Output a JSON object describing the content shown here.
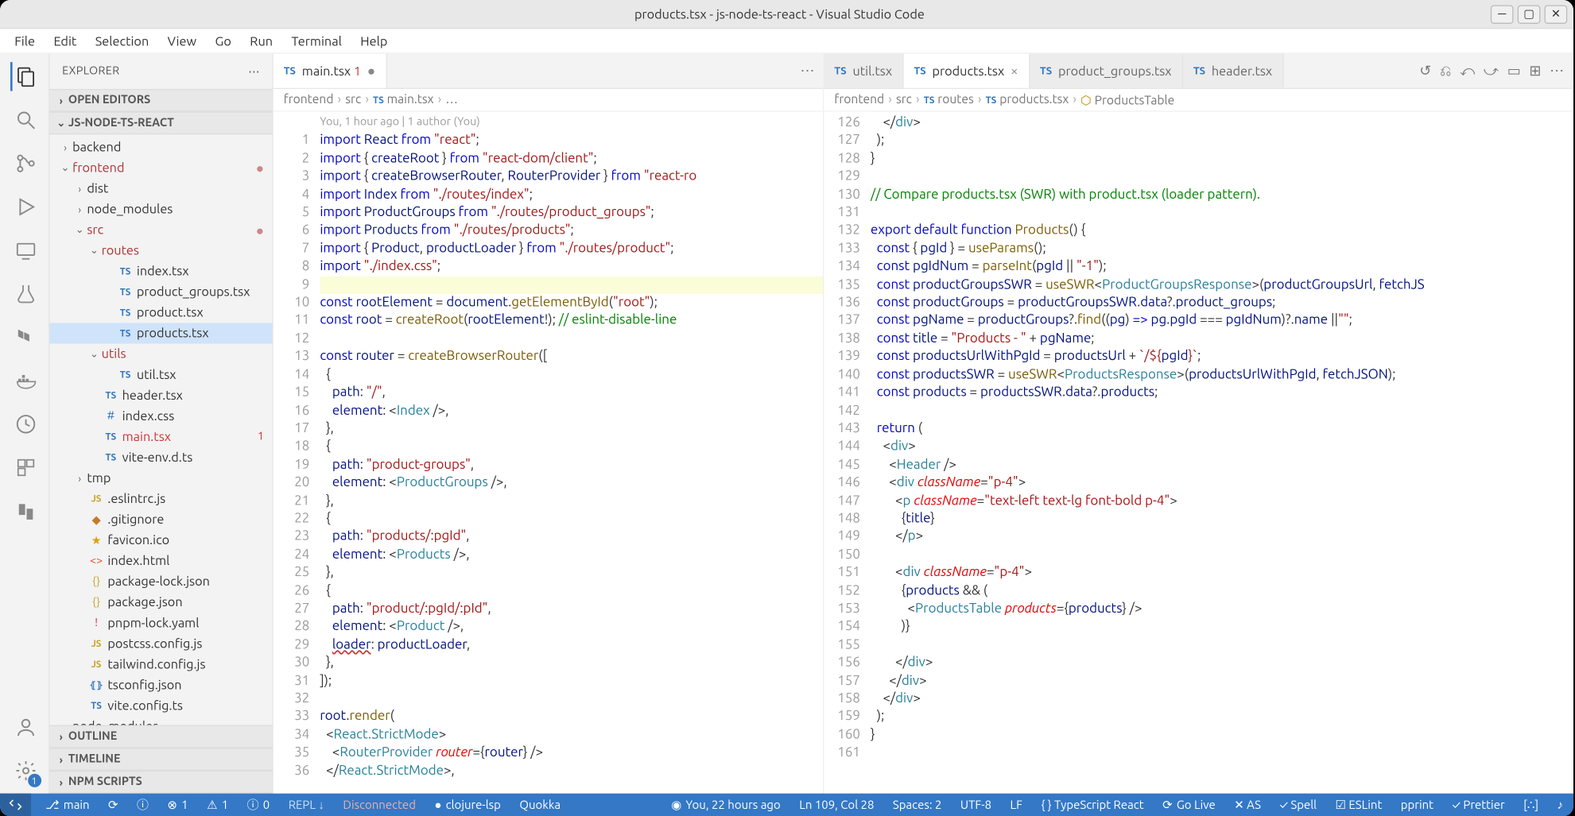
{
  "title": "products.tsx - js-node-ts-react - Visual Studio Code",
  "menu": [
    "File",
    "Edit",
    "Selection",
    "View",
    "Go",
    "Run",
    "Terminal",
    "Help"
  ],
  "explorer": {
    "title": "EXPLORER",
    "sections": {
      "openEditors": "OPEN EDITORS",
      "project": "JS-NODE-TS-REACT",
      "outline": "OUTLINE",
      "timeline": "TIMELINE",
      "npm": "NPM SCRIPTS"
    },
    "tree": [
      {
        "depth": 0,
        "kind": "folder",
        "open": false,
        "label": "backend"
      },
      {
        "depth": 0,
        "kind": "folder",
        "open": true,
        "label": "frontend",
        "dot": true
      },
      {
        "depth": 1,
        "kind": "folder",
        "open": false,
        "label": "dist"
      },
      {
        "depth": 1,
        "kind": "folder",
        "open": false,
        "label": "node_modules"
      },
      {
        "depth": 1,
        "kind": "folder",
        "open": true,
        "label": "src",
        "dot": true
      },
      {
        "depth": 2,
        "kind": "folder",
        "open": true,
        "label": "routes"
      },
      {
        "depth": 3,
        "kind": "ts",
        "label": "index.tsx"
      },
      {
        "depth": 3,
        "kind": "ts",
        "label": "product_groups.tsx"
      },
      {
        "depth": 3,
        "kind": "ts",
        "label": "product.tsx"
      },
      {
        "depth": 3,
        "kind": "ts",
        "label": "products.tsx",
        "selected": true
      },
      {
        "depth": 2,
        "kind": "folder",
        "open": true,
        "label": "utils"
      },
      {
        "depth": 3,
        "kind": "ts",
        "label": "util.tsx"
      },
      {
        "depth": 2,
        "kind": "ts",
        "label": "header.tsx"
      },
      {
        "depth": 2,
        "kind": "css",
        "label": "index.css"
      },
      {
        "depth": 2,
        "kind": "ts",
        "label": "main.tsx",
        "err": "1"
      },
      {
        "depth": 2,
        "kind": "ts",
        "label": "vite-env.d.ts"
      },
      {
        "depth": 1,
        "kind": "folder",
        "open": false,
        "label": "tmp"
      },
      {
        "depth": 1,
        "kind": "js",
        "label": ".eslintrc.js"
      },
      {
        "depth": 1,
        "kind": "git",
        "label": ".gitignore"
      },
      {
        "depth": 1,
        "kind": "star",
        "label": "favicon.ico"
      },
      {
        "depth": 1,
        "kind": "html",
        "label": "index.html"
      },
      {
        "depth": 1,
        "kind": "json",
        "label": "package-lock.json"
      },
      {
        "depth": 1,
        "kind": "json",
        "label": "package.json"
      },
      {
        "depth": 1,
        "kind": "yaml",
        "label": "pnpm-lock.yaml"
      },
      {
        "depth": 1,
        "kind": "js",
        "label": "postcss.config.js"
      },
      {
        "depth": 1,
        "kind": "js",
        "label": "tailwind.config.js"
      },
      {
        "depth": 1,
        "kind": "tsconf",
        "label": "tsconfig.json"
      },
      {
        "depth": 1,
        "kind": "ts",
        "label": "vite.config.ts"
      },
      {
        "depth": 0,
        "kind": "folder",
        "open": false,
        "label": "node_modules"
      }
    ]
  },
  "leftGroup": {
    "tabs": [
      {
        "label": "main.tsx",
        "dirty": true,
        "active": true,
        "badge": "1"
      }
    ],
    "actionsEllipsis": "⋯",
    "breadcrumb": [
      "frontend",
      "src",
      "main.tsx",
      "…"
    ],
    "codelens": "You, 1 hour ago | 1 author (You)",
    "startLine": 1,
    "lines": [
      "<span class='tok-kw'>import</span> <span class='tok-var'>React</span> <span class='tok-kw'>from</span> <span class='tok-str'>\"react\"</span>;",
      "<span class='tok-kw'>import</span> { <span class='tok-var'>createRoot</span> } <span class='tok-kw'>from</span> <span class='tok-str'>\"react-dom/client\"</span>;",
      "<span class='tok-kw'>import</span> { <span class='tok-var'>createBrowserRouter</span>, <span class='tok-var'>RouterProvider</span> } <span class='tok-kw'>from</span> <span class='tok-str'>\"react-ro</span>",
      "<span class='tok-kw'>import</span> <span class='tok-var'>Index</span> <span class='tok-kw'>from</span> <span class='tok-str'>\"./routes/index\"</span>;",
      "<span class='tok-kw'>import</span> <span class='tok-var'>ProductGroups</span> <span class='tok-kw'>from</span> <span class='tok-str'>\"./routes/product_groups\"</span>;",
      "<span class='tok-kw'>import</span> <span class='tok-var'>Products</span> <span class='tok-kw'>from</span> <span class='tok-str'>\"./routes/products\"</span>;",
      "<span class='tok-kw'>import</span> { <span class='tok-var'>Product</span>, <span class='tok-var'>productLoader</span> } <span class='tok-kw'>from</span> <span class='tok-str'>\"./routes/product\"</span>;",
      "<span class='tok-kw'>import</span> <span class='tok-str'>\"./index.css\"</span>;",
      "<span class='hl-line'> </span>",
      "<span class='tok-kw'>const</span> <span class='tok-var'>rootElement</span> = <span class='tok-var'>document</span>.<span class='tok-fn'>getElementById</span>(<span class='tok-str'>\"root\"</span>);",
      "<span class='tok-kw'>const</span> <span class='tok-var'>root</span> = <span class='tok-fn'>createRoot</span>(<span class='tok-var'>rootElement</span>!); <span class='tok-comment'>// eslint-disable-line</span>",
      "",
      "<span class='tok-kw'>const</span> <span class='tok-var'>router</span> = <span class='tok-fn'>createBrowserRouter</span>([",
      "  {",
      "    <span class='tok-var'>path</span>: <span class='tok-str'>\"/\"</span>,",
      "    <span class='tok-var'>element</span>: &lt;<span class='tok-type'>Index</span> /&gt;,",
      "  },",
      "  {",
      "    <span class='tok-var'>path</span>: <span class='tok-str'>\"product-groups\"</span>,",
      "    <span class='tok-var'>element</span>: &lt;<span class='tok-type'>ProductGroups</span> /&gt;,",
      "  },",
      "  {",
      "    <span class='tok-var'>path</span>: <span class='tok-str'>\"products/:pgId\"</span>,",
      "    <span class='tok-var'>element</span>: &lt;<span class='tok-type'>Products</span> /&gt;,",
      "  },",
      "  {",
      "    <span class='tok-var'>path</span>: <span class='tok-str'>\"product/:pgId/:pId\"</span>,",
      "    <span class='tok-var'>element</span>: &lt;<span class='tok-type'>Product</span> /&gt;,",
      "    <span class='tok-var err-sq'>loader</span>: <span class='tok-var'>productLoader</span>,",
      "  },",
      "]);",
      "",
      "<span class='tok-var'>root</span>.<span class='tok-fn'>render</span>(",
      "  &lt;<span class='tok-type'>React.StrictMode</span>&gt;",
      "    &lt;<span class='tok-type'>RouterProvider</span> <span class='tok-attr'>router</span>={<span class='tok-var'>router</span>} /&gt;",
      "  &lt;/<span class='tok-type'>React.StrictMode</span>&gt;,"
    ]
  },
  "rightGroup": {
    "tabs": [
      {
        "label": "util.tsx",
        "active": false
      },
      {
        "label": "products.tsx",
        "active": true,
        "close": "×"
      },
      {
        "label": "product_groups.tsx",
        "active": false
      },
      {
        "label": "header.tsx",
        "active": false
      }
    ],
    "toolbarIcons": [
      "↺",
      "⎌",
      "⤺",
      "⤻",
      "▭",
      "⊞",
      "⋯"
    ],
    "breadcrumb": [
      "frontend",
      "src",
      "routes",
      "products.tsx",
      "ProductsTable"
    ],
    "startLine": 126,
    "lines": [
      "    &lt;/<span class='tok-type'>div</span>&gt;",
      "  );",
      "}",
      "",
      "<span class='tok-comment'>// Compare products.tsx (SWR) with product.tsx (loader pattern).</span>",
      "",
      "<span class='tok-kw'>export</span> <span class='tok-kw'>default</span> <span class='tok-kw'>function</span> <span class='tok-fn'>Products</span>() {",
      "  <span class='tok-kw'>const</span> { <span class='tok-var'>pgId</span> } = <span class='tok-fn'>useParams</span>();",
      "  <span class='tok-kw'>const</span> <span class='tok-var'>pgIdNum</span> = <span class='tok-fn'>parseInt</span>(<span class='tok-var'>pgId</span> || <span class='tok-str'>\"-1\"</span>);",
      "  <span class='tok-kw'>const</span> <span class='tok-var'>productGroupsSWR</span> = <span class='tok-fn'>useSWR</span>&lt;<span class='tok-type'>ProductGroupsResponse</span>&gt;(<span class='tok-var'>productGroupsUrl</span>, <span class='tok-var'>fetchJS</span>",
      "  <span class='tok-kw'>const</span> <span class='tok-var'>productGroups</span> = <span class='tok-var'>productGroupsSWR</span>.<span class='tok-var'>data</span>?.<span class='tok-var'>product_groups</span>;",
      "  <span class='tok-kw'>const</span> <span class='tok-var'>pgName</span> = <span class='tok-var'>productGroups</span>?.<span class='tok-fn'>find</span>((<span class='tok-var'>pg</span>) <span class='tok-kw'>=&gt;</span> <span class='tok-var'>pg</span>.<span class='tok-var'>pgId</span> === <span class='tok-var'>pgIdNum</span>)?.<span class='tok-var'>name</span> ||<span class='tok-str'>\"\"</span>;",
      "  <span class='tok-kw'>const</span> <span class='tok-var'>title</span> = <span class='tok-str'>\"Products - \"</span> + <span class='tok-var'>pgName</span>;",
      "  <span class='tok-kw'>const</span> <span class='tok-var'>productsUrlWithPgId</span> = <span class='tok-var'>productsUrl</span> + <span class='tok-str'>`/${</span><span class='tok-var'>pgId</span><span class='tok-str'>}`</span>;",
      "  <span class='tok-kw'>const</span> <span class='tok-var'>productsSWR</span> = <span class='tok-fn'>useSWR</span>&lt;<span class='tok-type'>ProductsResponse</span>&gt;(<span class='tok-var'>productsUrlWithPgId</span>, <span class='tok-var'>fetchJSON</span>);",
      "  <span class='tok-kw'>const</span> <span class='tok-var'>products</span> = <span class='tok-var'>productsSWR</span>.<span class='tok-var'>data</span>?.<span class='tok-var'>products</span>;",
      "",
      "  <span class='tok-kw'>return</span> (",
      "    &lt;<span class='tok-type'>div</span>&gt;",
      "      &lt;<span class='tok-type'>Header</span> /&gt;",
      "      &lt;<span class='tok-type'>div</span> <span class='tok-attr'>className</span>=<span class='tok-str'>\"p-4\"</span>&gt;",
      "        &lt;<span class='tok-type'>p</span> <span class='tok-attr'>className</span>=<span class='tok-str'>\"text-left text-lg font-bold p-4\"</span>&gt;",
      "          {<span class='tok-var'>title</span>}",
      "        &lt;/<span class='tok-type'>p</span>&gt;",
      "",
      "        &lt;<span class='tok-type'>div</span> <span class='tok-attr'>className</span>=<span class='tok-str'>\"p-4\"</span>&gt;",
      "          {<span class='tok-var'>products</span> &amp;&amp; (",
      "            &lt;<span class='tok-type'>ProductsTable</span> <span class='tok-attr'>products</span>={<span class='tok-var'>products</span>} /&gt;",
      "          )}",
      "",
      "        &lt;/<span class='tok-type'>div</span>&gt;",
      "      &lt;/<span class='tok-type'>div</span>&gt;",
      "    &lt;/<span class='tok-type'>div</span>&gt;",
      "  );",
      "}",
      ""
    ]
  },
  "status": {
    "left": [
      {
        "icon": "⎇",
        "text": "main"
      },
      {
        "icon": "⟳",
        "text": ""
      },
      {
        "icon": "ⓘ",
        "text": ""
      },
      {
        "icon": "⊗",
        "text": "1"
      },
      {
        "icon": "⚠",
        "text": "1"
      },
      {
        "icon": "ⓘ",
        "text": "0"
      },
      {
        "text": "REPL ↓",
        "dim": true
      },
      {
        "text": "Disconnected",
        "disc": true
      },
      {
        "icon": "●",
        "text": "clojure-lsp"
      },
      {
        "text": "Quokka"
      }
    ],
    "right": [
      {
        "icon": "◉",
        "text": "You, 22 hours ago"
      },
      {
        "text": "Ln 109, Col 28"
      },
      {
        "text": "Spaces: 2"
      },
      {
        "text": "UTF-8"
      },
      {
        "text": "LF"
      },
      {
        "text": "{ } TypeScript React"
      },
      {
        "icon": "⟳",
        "text": "Go Live"
      },
      {
        "text": "✕ AS"
      },
      {
        "text": "✓ Spell"
      },
      {
        "text": "☑ ESLint"
      },
      {
        "text": "pprint"
      },
      {
        "text": "✓ Prettier"
      },
      {
        "text": "[∴]"
      },
      {
        "text": "♪"
      }
    ]
  }
}
